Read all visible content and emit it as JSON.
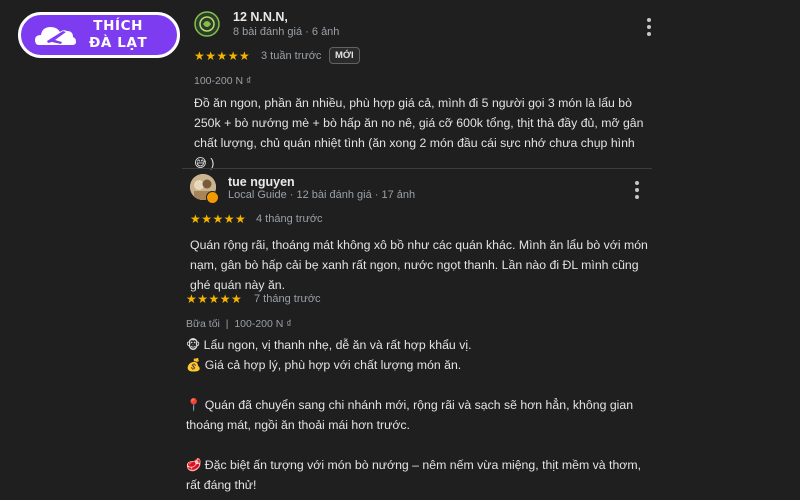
{
  "logo": {
    "line1": "THÍCH",
    "line2": "ĐÀ LẠT"
  },
  "review1": {
    "name": "12 N.N.N,",
    "meta": "8 bài đánh giá · 6 ảnh",
    "stars": "★★★★★",
    "time": "3 tuần trước",
    "badge": "MỚI",
    "price": "100-200 N ₫",
    "text_lines": [
      "Đồ ăn ngon, phần ăn nhiều, phù hợp giá cả, mình đi 5 người gọi 3 món là lẩu bò",
      "250k + bò nướng mè + bò hấp ăn no nê, giá cỡ 600k tổng, thịt thà đầy đủ, mỡ gân",
      "chất lượng, chủ quán nhiệt tình (ăn xong 2 món đầu cái sực nhớ chưa chụp hình",
      "😅 )"
    ]
  },
  "review2": {
    "name": "tue nguyen",
    "meta": "Local Guide · 12 bài đánh giá · 17 ảnh",
    "stars": "★★★★★",
    "time": "4 tháng trước",
    "text_lines": [
      "Quán rộng rãi, thoáng mát không xô bồ như các quán khác. Mình ăn lẩu bò với món",
      "nạm, gân bò hấp cải bẹ xanh rất ngon, nước ngọt thanh. Lần nào đi ĐL mình cũng",
      "ghé quán này ăn."
    ],
    "update": {
      "stars": "★★★★★",
      "time": "7 tháng trước",
      "meal": "Bữa tối",
      "separator": "|",
      "price": "100-200 N ₫",
      "lines": [
        "🐵 Lẩu ngon, vị thanh nhẹ, dễ ăn và rất hợp khẩu vị.",
        "💰 Giá cả hợp lý, phù hợp với chất lượng món ăn.",
        "📍 Quán đã chuyển sang chi nhánh mới, rộng rãi và sạch sẽ hơn hẳn, không gian",
        "thoáng mát, ngồi ăn thoải mái hơn trước.",
        "🥩 Đặc biệt ấn tượng với món bò nướng – nêm nếm vừa miệng, thịt mềm và thơm,",
        "rất đáng thử!"
      ]
    }
  }
}
